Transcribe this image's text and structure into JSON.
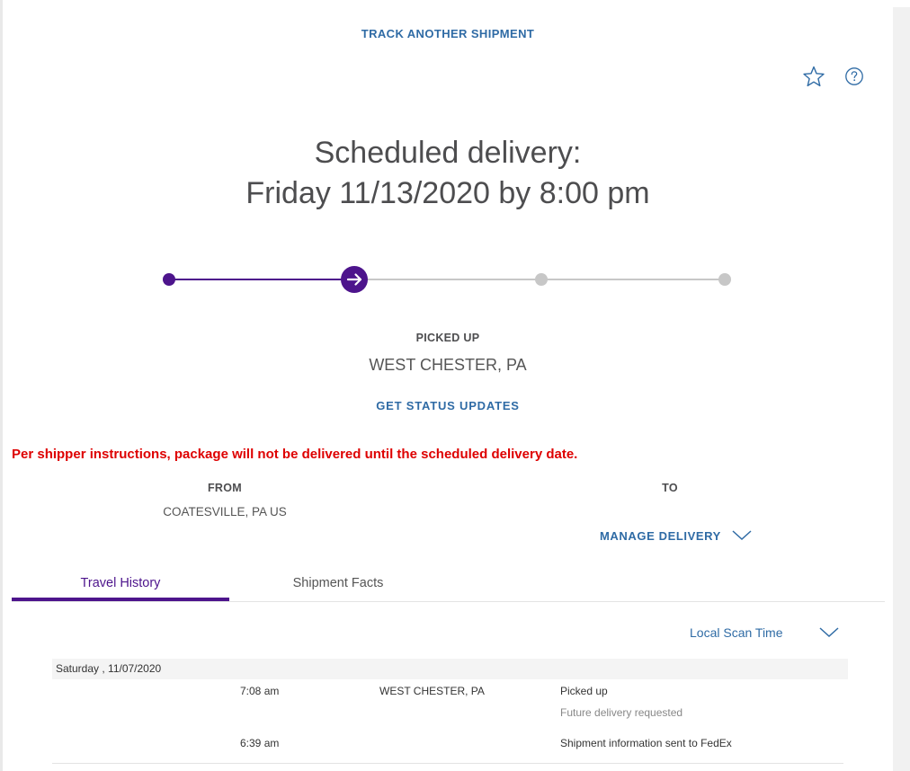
{
  "header": {
    "track_another": "TRACK ANOTHER SHIPMENT",
    "icons": [
      "star-icon",
      "help-icon"
    ]
  },
  "delivery": {
    "line1": "Scheduled delivery:",
    "line2": "Friday 11/13/2020 by 8:00 pm"
  },
  "progress": {
    "steps_total": 4,
    "current_step": 2,
    "completed_color": "#4d148c",
    "pending_color": "#c7c7c7"
  },
  "status": {
    "label": "PICKED UP",
    "location": "WEST CHESTER, PA",
    "updates_link": "GET STATUS UPDATES"
  },
  "warning": "Per shipper instructions, package will not be delivered until the scheduled delivery date.",
  "route": {
    "from_label": "FROM",
    "from_value": "COATESVILLE, PA US",
    "to_label": "TO",
    "manage_label": "MANAGE DELIVERY"
  },
  "tabs": [
    {
      "label": "Travel History",
      "active": true
    },
    {
      "label": "Shipment Facts",
      "active": false
    }
  ],
  "scan_time": {
    "selected": "Local Scan Time"
  },
  "history": {
    "date": "Saturday , 11/07/2020",
    "events": [
      {
        "time": "7:08 am",
        "location": "WEST CHESTER, PA",
        "status": "Picked up",
        "detail": "Future delivery requested"
      },
      {
        "time": "6:39 am",
        "location": "",
        "status": "Shipment information sent to FedEx",
        "detail": ""
      }
    ]
  },
  "colors": {
    "link_blue": "#2f6ba5",
    "fedex_purple": "#4d148c",
    "warning_red": "#de0000"
  }
}
